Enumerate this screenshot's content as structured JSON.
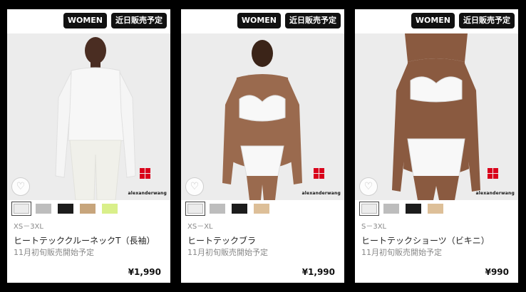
{
  "products": [
    {
      "badge_gender": "WOMEN",
      "badge_status": "近日販売予定",
      "swatches": [
        "#ececec",
        "#bdbdbd",
        "#1c1c1c",
        "#c7a57c",
        "#d9ef8a"
      ],
      "size_range": "XS－3XL",
      "name": "ヒートテッククルーネックT（長袖）",
      "release": "11月初旬販売開始予定",
      "price": "¥1,990",
      "brand_mark": "alexanderwang"
    },
    {
      "badge_gender": "WOMEN",
      "badge_status": "近日販売予定",
      "swatches": [
        "#ececec",
        "#bdbdbd",
        "#1c1c1c",
        "#ddbf98"
      ],
      "size_range": "XS－XL",
      "name": "ヒートテックブラ",
      "release": "11月初旬販売開始予定",
      "price": "¥1,990",
      "brand_mark": "alexanderwang"
    },
    {
      "badge_gender": "WOMEN",
      "badge_status": "近日販売予定",
      "swatches": [
        "#ececec",
        "#bdbdbd",
        "#1c1c1c",
        "#ddbf98"
      ],
      "size_range": "S－3XL",
      "name": "ヒートテックショーツ（ビキニ）",
      "release": "11月初旬販売開始予定",
      "price": "¥990",
      "brand_mark": "alexanderwang"
    }
  ]
}
